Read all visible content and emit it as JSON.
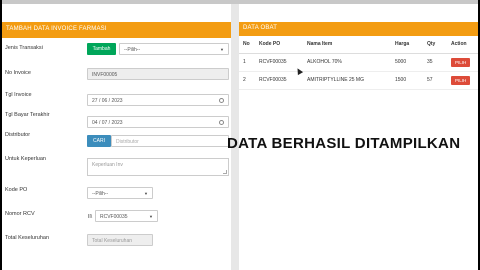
{
  "form": {
    "header": "TAMBAH DATA INVOICE FARMASI",
    "jenis_label": "Jenis Transaksi",
    "tambah_button": "Tambah",
    "pilih_placeholder": "--Pilih--",
    "no_invoice_label": "No Invoice",
    "no_invoice_value": "INVF00005",
    "tgl_invoice_label": "Tgl Invoice",
    "tgl_invoice_value": "27 / 06 / 2023",
    "tgl_bayar_label": "Tgl Bayar Terakhir",
    "tgl_bayar_value": "04 / 07 / 2023",
    "distributor_label": "Distributor",
    "cari_button": "CARI",
    "distributor_placeholder": "Distributor",
    "keperluan_label": "Untuk Keperluan",
    "keperluan_placeholder": "Keperluan Inv",
    "kode_po_label": "Kode PO",
    "kode_po_value": "--Pilih--",
    "nomor_rcv_label": "Nomor RCV",
    "rcv_prefix": "II\\",
    "nomor_rcv_value": "RCVF00035",
    "total_label": "Total Keseluruhan",
    "total_placeholder": "Total Keseluruhan"
  },
  "obat": {
    "header": "DATA OBAT",
    "columns": [
      "No",
      "Kode PO",
      "Nama Item",
      "Harga",
      "Qty",
      "Action"
    ],
    "rows": [
      {
        "no": "1",
        "kode": "RCVF00035",
        "nama": "ALKOHOL 70%",
        "harga": "5000",
        "qty": "35",
        "action": "PILIH"
      },
      {
        "no": "2",
        "kode": "RCVF00035",
        "nama": "AMITRIPTYLLINE 25 MG",
        "harga": "1500",
        "qty": "57",
        "action": "PILIH"
      }
    ]
  },
  "overlay": "DATA BERHASIL DITAMPILKAN"
}
